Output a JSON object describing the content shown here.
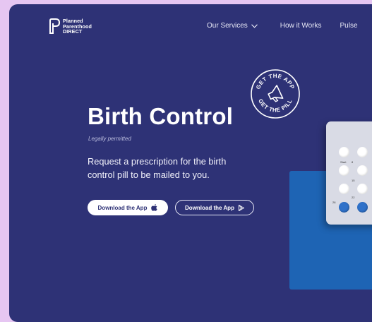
{
  "header": {
    "logo": {
      "line1": "Planned",
      "line2": "Parenthood",
      "line3": "DIRECT"
    },
    "nav": [
      {
        "label": "Our Services",
        "has_dropdown": true
      },
      {
        "label": "How it Works",
        "has_dropdown": false
      },
      {
        "label": "Pulse",
        "has_dropdown": false
      }
    ]
  },
  "hero": {
    "title": "Birth Control",
    "subtitle": "Legally permitted",
    "description": "Request a prescription for the birth control pill to be mailed to you.",
    "buttons": [
      {
        "label": "Download the App",
        "icon": "apple-icon"
      },
      {
        "label": "Download the App",
        "icon": "play-store-icon"
      }
    ]
  },
  "badge": {
    "top_text": "GET THE APP",
    "bottom_text": "GET THE PILL",
    "icon": "megaphone-icon"
  },
  "pill_pack": {
    "labels": [
      "Start",
      "8",
      "15",
      "22",
      "28"
    ]
  },
  "colors": {
    "page_background": "#e6c6f2",
    "hero_background": "#2e3276",
    "card_blue": "#1e64b4",
    "pill_blue": "#2f71c9"
  }
}
